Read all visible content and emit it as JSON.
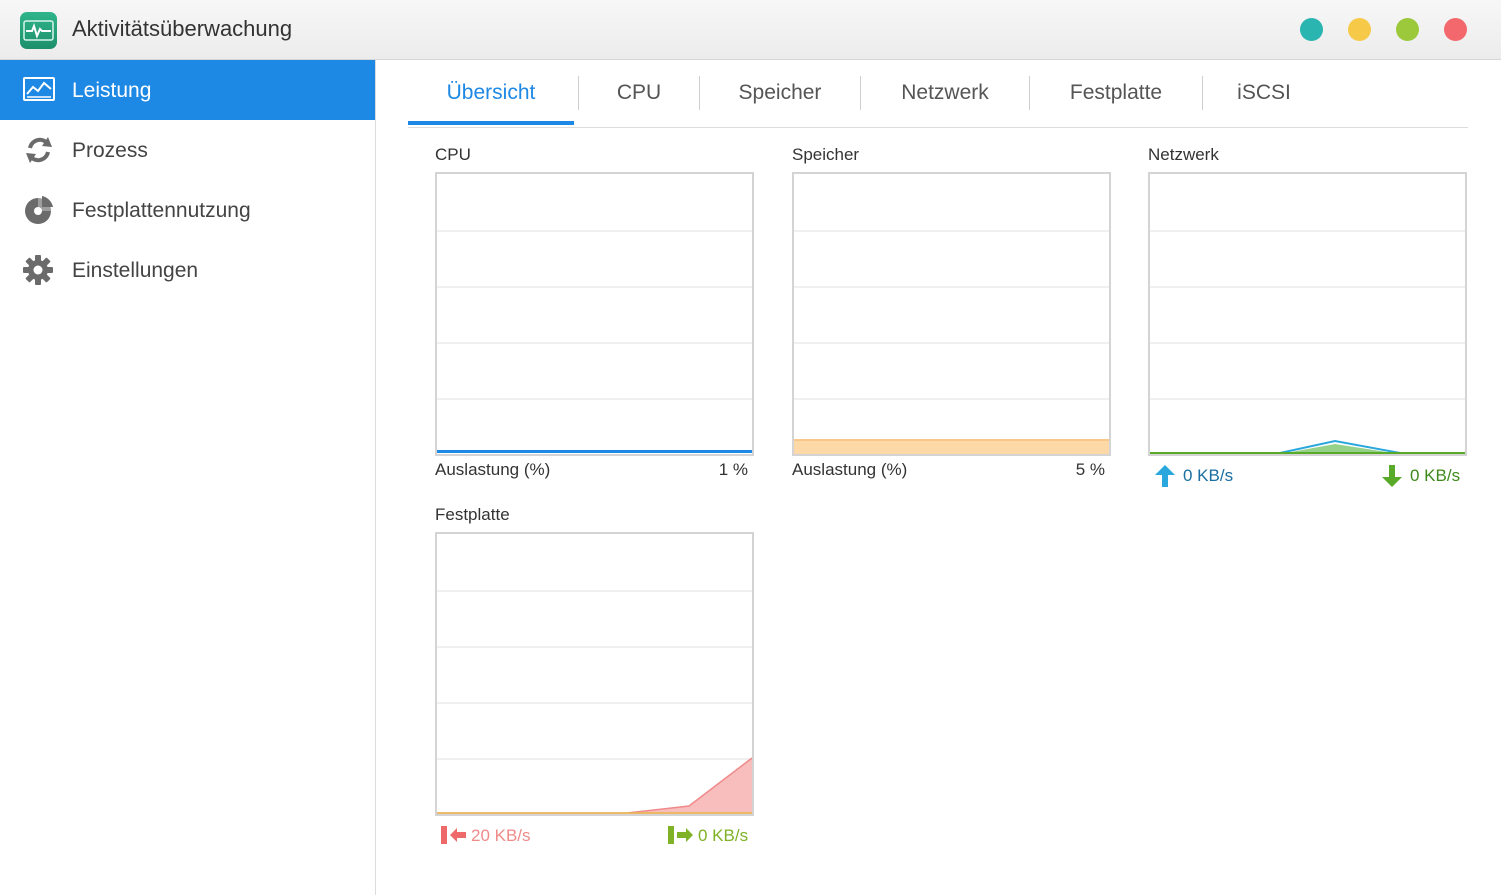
{
  "app": {
    "title": "Aktivitätsüberwachung",
    "icon": "activity-monitor-icon",
    "window_buttons": [
      {
        "name": "teal-button",
        "color": "#2bb5b0"
      },
      {
        "name": "minimize-button",
        "color": "#f7c948"
      },
      {
        "name": "maximize-button",
        "color": "#9cc83b"
      },
      {
        "name": "close-button",
        "color": "#f2686c"
      }
    ]
  },
  "sidebar": {
    "items": [
      {
        "label": "Leistung",
        "icon": "performance-chart-icon",
        "active": true
      },
      {
        "label": "Prozess",
        "icon": "process-refresh-icon",
        "active": false
      },
      {
        "label": "Festplattennutzung",
        "icon": "disk-usage-icon",
        "active": false
      },
      {
        "label": "Einstellungen",
        "icon": "gear-icon",
        "active": false
      }
    ]
  },
  "tabs": [
    {
      "label": "Übersicht",
      "active": true
    },
    {
      "label": "CPU",
      "active": false
    },
    {
      "label": "Speicher",
      "active": false
    },
    {
      "label": "Netzwerk",
      "active": false
    },
    {
      "label": "Festplatte",
      "active": false
    },
    {
      "label": "iSCSI",
      "active": false
    }
  ],
  "colors": {
    "accent": "#1e88e5",
    "cpu_line": "#1e88e5",
    "memory_fill": "#fdd9a8",
    "memory_line": "#f7c88a",
    "net_up": "#2aa7dc",
    "net_down": "#5aaa2a",
    "disk_read": "#f08a8a",
    "disk_write": "#7fb226"
  },
  "panels": {
    "cpu": {
      "title": "CPU",
      "label": "Auslastung (%)",
      "value": "1 %",
      "usage_percent": 1
    },
    "memory": {
      "title": "Speicher",
      "label": "Auslastung (%)",
      "value": "5 %",
      "usage_percent": 5
    },
    "network": {
      "title": "Netzwerk",
      "upload": "0 KB/s",
      "download": "0 KB/s",
      "upload_icon": "arrow-up-icon",
      "download_icon": "arrow-down-icon"
    },
    "disk": {
      "title": "Festplatte",
      "read": "20 KB/s",
      "write": "0 KB/s",
      "read_icon": "disk-read-icon",
      "write_icon": "disk-write-icon"
    }
  }
}
